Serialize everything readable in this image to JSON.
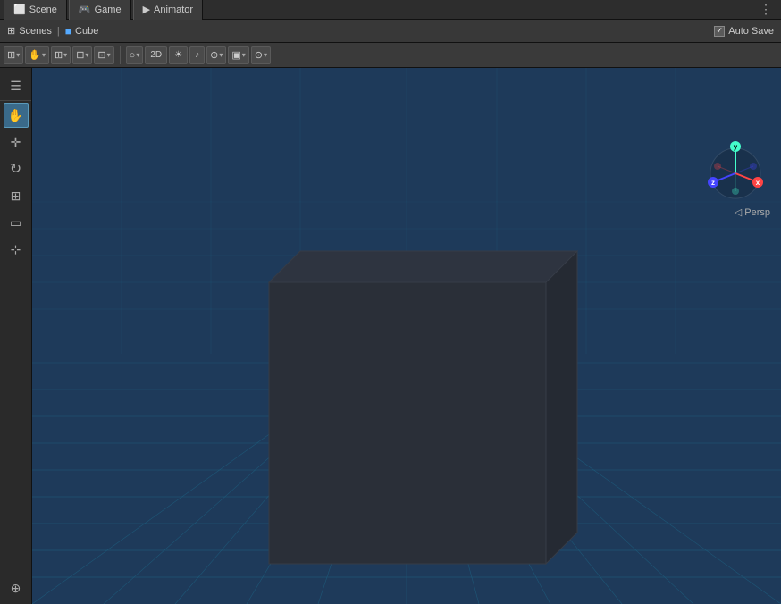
{
  "tabs": [
    {
      "label": "Scene",
      "icon": "scene-icon",
      "active": false
    },
    {
      "label": "Game",
      "icon": "game-icon",
      "active": false
    },
    {
      "label": "Animator",
      "icon": "animator-icon",
      "active": false
    }
  ],
  "tab_more_label": "⋮",
  "breadcrumb": {
    "scenes_icon": "≡",
    "scenes_label": "Scenes",
    "separator": "|",
    "cube_icon": "⬛",
    "cube_label": "Cube"
  },
  "auto_save": {
    "checkbox_checked": "✓",
    "label": "Auto Save"
  },
  "toolbar": {
    "layout_btn": "☰",
    "hand_btn": "✋",
    "move_btn": "⊕",
    "rotate_btn": "↻",
    "scale_btn": "⊞",
    "rect_btn": "▭",
    "transform_btn": "⊹",
    "grid_btn": "⊞",
    "snap_btn": "⊡",
    "camera_btn": "○",
    "two_d_btn": "2D",
    "light_btn": "☀",
    "audio_btn": "♪",
    "layers_btn": "⊕",
    "display_btn": "▣",
    "dropdown_arrow": "▾"
  },
  "viewport": {
    "persp_label": "◁ Persp",
    "background_color": "#1e3a5a",
    "grid_color": "#1e5a7a"
  },
  "gizmo": {
    "y_label": "y",
    "x_label": "x",
    "z_label": "z"
  },
  "tools": [
    {
      "icon": "☰",
      "name": "layout-tool",
      "active": false
    },
    {
      "icon": "✋",
      "name": "hand-tool",
      "active": false
    },
    {
      "icon": "✛",
      "name": "move-tool",
      "active": false
    },
    {
      "icon": "↻",
      "name": "rotate-tool",
      "active": false
    },
    {
      "icon": "⊞",
      "name": "scale-tool",
      "active": false
    },
    {
      "icon": "▭",
      "name": "rect-tool",
      "active": false
    },
    {
      "icon": "⊹",
      "name": "transform-tool",
      "active": false
    },
    {
      "icon": "⊕",
      "name": "custom-tool",
      "active": false
    }
  ]
}
